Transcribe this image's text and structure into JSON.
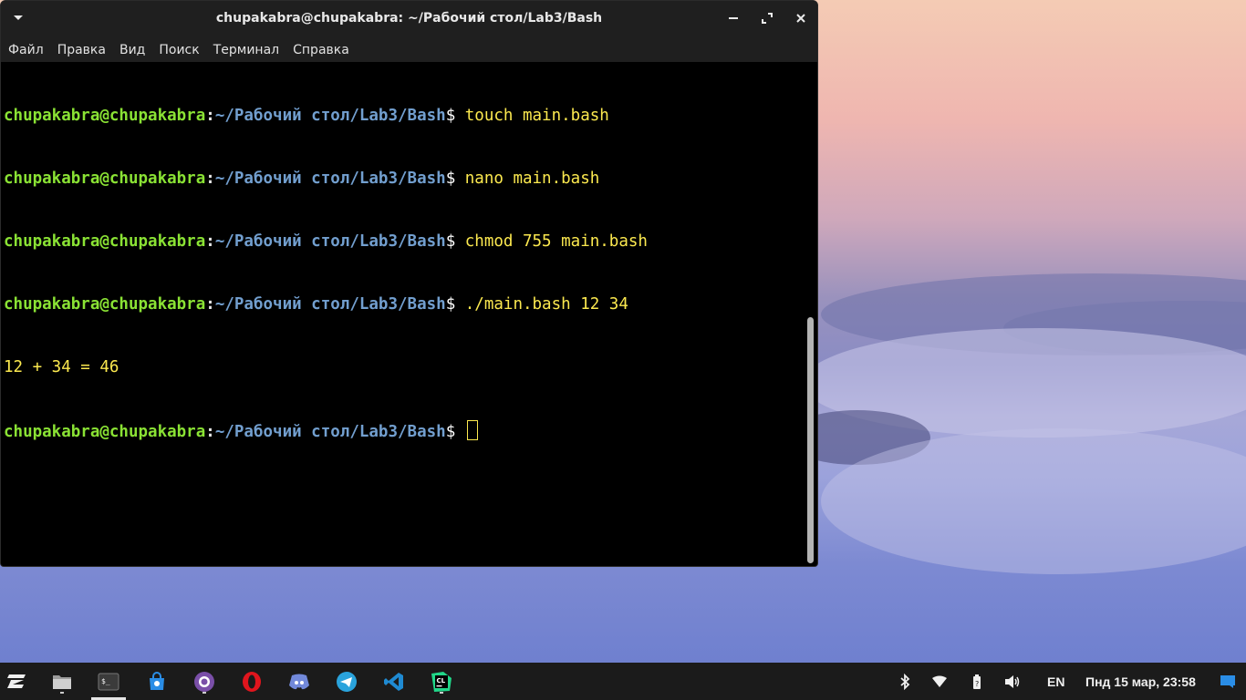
{
  "window": {
    "title": "chupakabra@chupakabra: ~/Рабочий стол/Lab3/Bash",
    "menu": [
      "Файл",
      "Правка",
      "Вид",
      "Поиск",
      "Терминал",
      "Справка"
    ]
  },
  "terminal": {
    "prompt": {
      "user": "chupakabra@chupakabra",
      "colon": ":",
      "path": "~/Рабочий стол/Lab3/Bash",
      "symbol": "$"
    },
    "lines": [
      {
        "cmd": " touch main.bash"
      },
      {
        "cmd": " nano main.bash"
      },
      {
        "cmd": " chmod 755 main.bash"
      },
      {
        "cmd": " ./main.bash 12 34"
      }
    ],
    "output": "12 + 34 = 46",
    "last_prompt_cmd": " "
  },
  "taskbar": {
    "apps": [
      "zorin-menu-icon",
      "files-icon",
      "terminal-icon",
      "store-icon",
      "github-desktop-icon",
      "opera-icon",
      "discord-icon",
      "telegram-icon",
      "vscode-icon",
      "clion-icon"
    ],
    "language": "EN",
    "clock": "Пнд 15 мар, 23:58"
  },
  "colors": {
    "prompt_user": "#8ae234",
    "prompt_path": "#729fcf",
    "command_text": "#fce94f",
    "terminal_bg": "#000000",
    "taskbar_bg": "#1b1b1b"
  }
}
